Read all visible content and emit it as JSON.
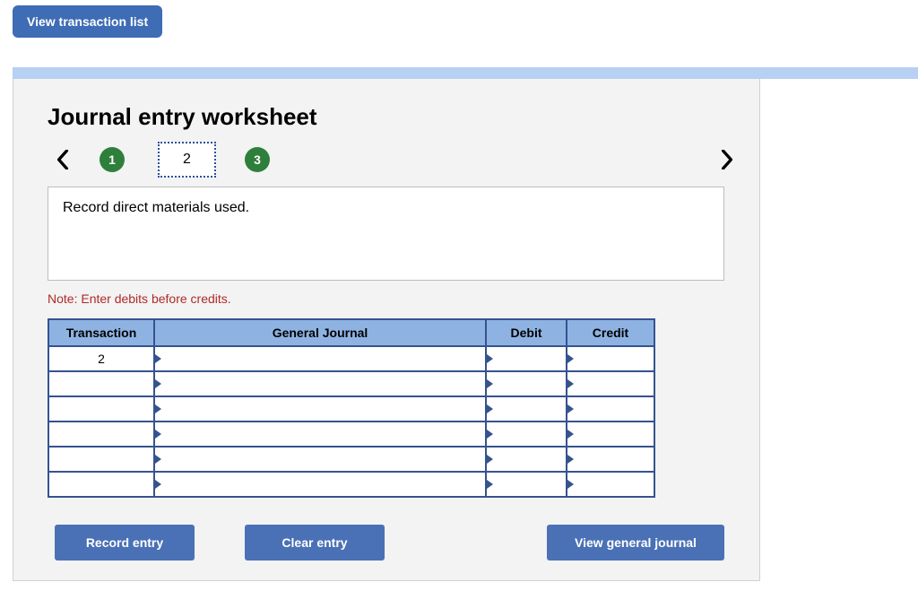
{
  "header": {
    "view_list_label": "View transaction list"
  },
  "worksheet": {
    "title": "Journal entry worksheet",
    "steps": {
      "s1": "1",
      "s2": "2",
      "s3": "3"
    },
    "prompt": "Record direct materials used.",
    "note": "Note: Enter debits before credits."
  },
  "table": {
    "headers": {
      "transaction": "Transaction",
      "general_journal": "General Journal",
      "debit": "Debit",
      "credit": "Credit"
    },
    "rows": [
      {
        "txn": "2",
        "gj": "",
        "debit": "",
        "credit": ""
      },
      {
        "txn": "",
        "gj": "",
        "debit": "",
        "credit": ""
      },
      {
        "txn": "",
        "gj": "",
        "debit": "",
        "credit": ""
      },
      {
        "txn": "",
        "gj": "",
        "debit": "",
        "credit": ""
      },
      {
        "txn": "",
        "gj": "",
        "debit": "",
        "credit": ""
      },
      {
        "txn": "",
        "gj": "",
        "debit": "",
        "credit": ""
      }
    ]
  },
  "buttons": {
    "record": "Record entry",
    "clear": "Clear entry",
    "view_gj": "View general journal"
  }
}
